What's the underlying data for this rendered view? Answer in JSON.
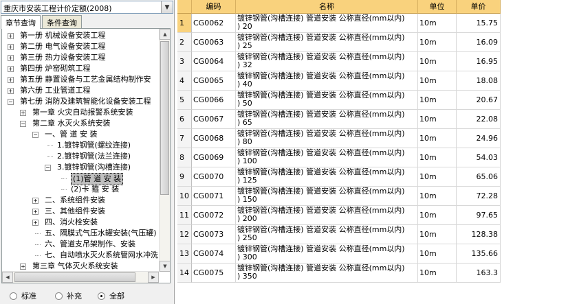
{
  "quota_selector": {
    "value": "重庆市安装工程计价定额(2008)"
  },
  "tabs": [
    "章节查询",
    "条件查询"
  ],
  "tree": [
    {
      "label": "第一册  机械设备安装工程",
      "level": 0,
      "exp": "+"
    },
    {
      "label": "第二册  电气设备安装工程",
      "level": 0,
      "exp": "+"
    },
    {
      "label": "第三册  热力设备安装工程",
      "level": 0,
      "exp": "+"
    },
    {
      "label": "第四册  炉窑砌筑工程",
      "level": 0,
      "exp": "+"
    },
    {
      "label": "第五册  静置设备与工艺金属结构制作安",
      "level": 0,
      "exp": "+"
    },
    {
      "label": "第六册  工业管道工程",
      "level": 0,
      "exp": "+"
    },
    {
      "label": "第七册  消防及建筑智能化设备安装工程",
      "level": 0,
      "exp": "-"
    },
    {
      "label": "第一章  火灾自动报警系统安装",
      "level": 1,
      "exp": "+"
    },
    {
      "label": "第二章  水灭火系统安装",
      "level": 1,
      "exp": "-"
    },
    {
      "label": "一、管  道  安  装",
      "level": 2,
      "exp": "-"
    },
    {
      "label": "1.镀锌钢管(螺纹连接)",
      "level": 3,
      "exp": ""
    },
    {
      "label": "2.镀锌钢管(法兰连接)",
      "level": 3,
      "exp": ""
    },
    {
      "label": "3.镀锌钢管(沟槽连接)",
      "level": 3,
      "exp": "-"
    },
    {
      "label": "(1)管  道  安  装",
      "level": 4,
      "exp": "",
      "selected": true
    },
    {
      "label": "(2)卡  箍  安  装",
      "level": 4,
      "exp": ""
    },
    {
      "label": "二、系统组件安装",
      "level": 2,
      "exp": "+"
    },
    {
      "label": "三、其他组件安装",
      "level": 2,
      "exp": "+"
    },
    {
      "label": "四、消火栓安装",
      "level": 2,
      "exp": "+"
    },
    {
      "label": "五、隔膜式气压水罐安装(气压罐)",
      "level": 2,
      "exp": ""
    },
    {
      "label": "六、管道支吊架制作、安装",
      "level": 2,
      "exp": ""
    },
    {
      "label": "七、自动喷水灭火系统管网水冲洗",
      "level": 2,
      "exp": ""
    },
    {
      "label": "第三章  气体灭火系统安装",
      "level": 1,
      "exp": "+"
    }
  ],
  "filter": {
    "options": [
      "标准",
      "补充",
      "全部"
    ],
    "selected": 2
  },
  "grid": {
    "headers": {
      "code": "编码",
      "name": "名称",
      "unit": "单位",
      "price": "单价"
    },
    "rows": [
      {
        "num": "1",
        "code": "CG0062",
        "name": "镀锌钢管(沟槽连接) 管道安装 公称直径(mm以内)\n) 20",
        "unit": "10m",
        "price": "15.75"
      },
      {
        "num": "2",
        "code": "CG0063",
        "name": "镀锌钢管(沟槽连接) 管道安装 公称直径(mm以内)\n) 25",
        "unit": "10m",
        "price": "16.09"
      },
      {
        "num": "3",
        "code": "CG0064",
        "name": "镀锌钢管(沟槽连接) 管道安装 公称直径(mm以内)\n) 32",
        "unit": "10m",
        "price": "16.95"
      },
      {
        "num": "4",
        "code": "CG0065",
        "name": "镀锌钢管(沟槽连接) 管道安装 公称直径(mm以内)\n) 40",
        "unit": "10m",
        "price": "18.08"
      },
      {
        "num": "5",
        "code": "CG0066",
        "name": "镀锌钢管(沟槽连接) 管道安装 公称直径(mm以内)\n) 50",
        "unit": "10m",
        "price": "20.67"
      },
      {
        "num": "6",
        "code": "CG0067",
        "name": "镀锌钢管(沟槽连接) 管道安装 公称直径(mm以内)\n) 65",
        "unit": "10m",
        "price": "22.08"
      },
      {
        "num": "7",
        "code": "CG0068",
        "name": "镀锌钢管(沟槽连接) 管道安装 公称直径(mm以内)\n) 80",
        "unit": "10m",
        "price": "24.96"
      },
      {
        "num": "8",
        "code": "CG0069",
        "name": "镀锌钢管(沟槽连接) 管道安装 公称直径(mm以内)\n) 100",
        "unit": "10m",
        "price": "54.03"
      },
      {
        "num": "9",
        "code": "CG0070",
        "name": "镀锌钢管(沟槽连接) 管道安装 公称直径(mm以内)\n) 125",
        "unit": "10m",
        "price": "65.06"
      },
      {
        "num": "10",
        "code": "CG0071",
        "name": "镀锌钢管(沟槽连接) 管道安装 公称直径(mm以内)\n) 150",
        "unit": "10m",
        "price": "72.28"
      },
      {
        "num": "11",
        "code": "CG0072",
        "name": "镀锌钢管(沟槽连接) 管道安装 公称直径(mm以内)\n) 200",
        "unit": "10m",
        "price": "97.65"
      },
      {
        "num": "12",
        "code": "CG0073",
        "name": "镀锌钢管(沟槽连接) 管道安装 公称直径(mm以内)\n) 250",
        "unit": "10m",
        "price": "128.38"
      },
      {
        "num": "13",
        "code": "CG0074",
        "name": "镀锌钢管(沟槽连接) 管道安装 公称直径(mm以内)\n) 300",
        "unit": "10m",
        "price": "135.66"
      },
      {
        "num": "14",
        "code": "CG0075",
        "name": "镀锌钢管(沟槽连接) 管道安装 公称直径(mm以内)\n) 350",
        "unit": "10m",
        "price": "163.3"
      }
    ]
  },
  "colors": {
    "header_bg": "#f9d27d",
    "selected_node_bg": "#c0c0c0",
    "panel_bg": "#f0f0f0"
  }
}
